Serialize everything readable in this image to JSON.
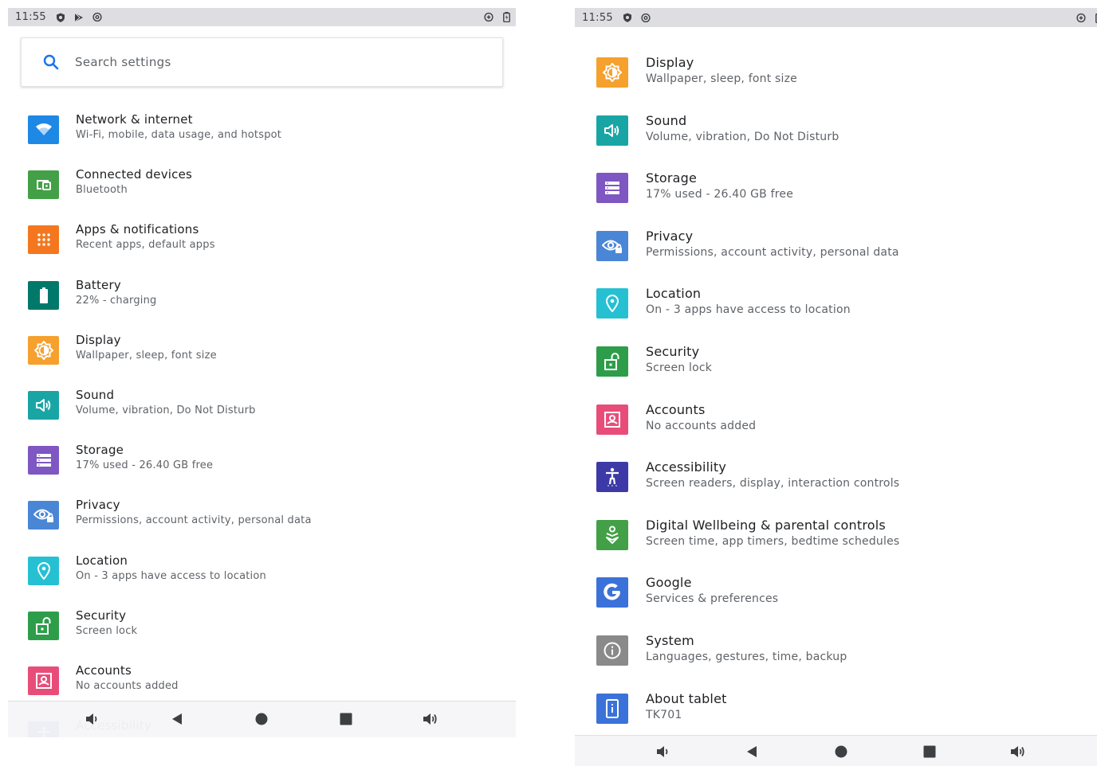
{
  "status_bar": {
    "time": "11:55",
    "left_icons": [
      "shield-icon",
      "play-store-icon",
      "at-sign-icon"
    ],
    "right_icons": [
      "data-saver-icon",
      "battery-charging-icon"
    ]
  },
  "search": {
    "placeholder": "Search settings",
    "icon": "search-icon"
  },
  "left_list": [
    {
      "id": "network",
      "title": "Network & internet",
      "subtitle": "Wi-Fi, mobile, data usage, and hotspot",
      "icon": "wifi-icon",
      "color": "#1e88e5"
    },
    {
      "id": "connected",
      "title": "Connected devices",
      "subtitle": "Bluetooth",
      "icon": "connected-devices-icon",
      "color": "#43a047"
    },
    {
      "id": "apps",
      "title": "Apps & notifications",
      "subtitle": "Recent apps, default apps",
      "icon": "apps-grid-icon",
      "color": "#f4771f"
    },
    {
      "id": "battery",
      "title": "Battery",
      "subtitle": "22% - charging",
      "icon": "battery-icon",
      "color": "#00796b"
    },
    {
      "id": "display",
      "title": "Display",
      "subtitle": "Wallpaper, sleep, font size",
      "icon": "brightness-icon",
      "color": "#f6a02d"
    },
    {
      "id": "sound",
      "title": "Sound",
      "subtitle": "Volume, vibration, Do Not Disturb",
      "icon": "volume-icon",
      "color": "#1aa5a5"
    },
    {
      "id": "storage",
      "title": "Storage",
      "subtitle": "17% used - 26.40 GB free",
      "icon": "storage-icon",
      "color": "#7e57c2"
    },
    {
      "id": "privacy",
      "title": "Privacy",
      "subtitle": "Permissions, account activity, personal data",
      "icon": "privacy-eye-icon",
      "color": "#4a86d6"
    },
    {
      "id": "location",
      "title": "Location",
      "subtitle": "On - 3 apps have access to location",
      "icon": "location-pin-icon",
      "color": "#26c0d3"
    },
    {
      "id": "security",
      "title": "Security",
      "subtitle": "Screen lock",
      "icon": "unlock-icon",
      "color": "#2e9d4a"
    },
    {
      "id": "accounts",
      "title": "Accounts",
      "subtitle": "No accounts added",
      "icon": "account-box-icon",
      "color": "#e84d7a"
    },
    {
      "id": "accessibility",
      "title": "Accessibility",
      "subtitle": "",
      "icon": "accessibility-icon",
      "color": "#3d3aa8"
    }
  ],
  "right_list": [
    {
      "id": "display",
      "title": "Display",
      "subtitle": "Wallpaper, sleep, font size",
      "icon": "brightness-icon",
      "color": "#f6a02d"
    },
    {
      "id": "sound",
      "title": "Sound",
      "subtitle": "Volume, vibration, Do Not Disturb",
      "icon": "volume-icon",
      "color": "#1aa5a5"
    },
    {
      "id": "storage",
      "title": "Storage",
      "subtitle": "17% used - 26.40 GB free",
      "icon": "storage-icon",
      "color": "#7e57c2"
    },
    {
      "id": "privacy",
      "title": "Privacy",
      "subtitle": "Permissions, account activity, personal data",
      "icon": "privacy-eye-icon",
      "color": "#4a86d6"
    },
    {
      "id": "location",
      "title": "Location",
      "subtitle": "On - 3 apps have access to location",
      "icon": "location-pin-icon",
      "color": "#26c0d3"
    },
    {
      "id": "security",
      "title": "Security",
      "subtitle": "Screen lock",
      "icon": "unlock-icon",
      "color": "#2e9d4a"
    },
    {
      "id": "accounts",
      "title": "Accounts",
      "subtitle": "No accounts added",
      "icon": "account-box-icon",
      "color": "#e84d7a"
    },
    {
      "id": "accessibility",
      "title": "Accessibility",
      "subtitle": "Screen readers, display, interaction controls",
      "icon": "accessibility-icon",
      "color": "#3d3aa8"
    },
    {
      "id": "wellbeing",
      "title": "Digital Wellbeing & parental controls",
      "subtitle": "Screen time, app timers, bedtime schedules",
      "icon": "wellbeing-icon",
      "color": "#43a047"
    },
    {
      "id": "google",
      "title": "Google",
      "subtitle": "Services & preferences",
      "icon": "google-g-icon",
      "color": "#3b72d9"
    },
    {
      "id": "system",
      "title": "System",
      "subtitle": "Languages, gestures, time, backup",
      "icon": "info-icon",
      "color": "#8a8a8a"
    },
    {
      "id": "about",
      "title": "About tablet",
      "subtitle": "TK701",
      "icon": "tablet-info-icon",
      "color": "#3b72d9"
    }
  ],
  "nav_bar": [
    "volume-down-icon",
    "back-icon",
    "home-icon",
    "recents-icon",
    "volume-up-icon"
  ]
}
